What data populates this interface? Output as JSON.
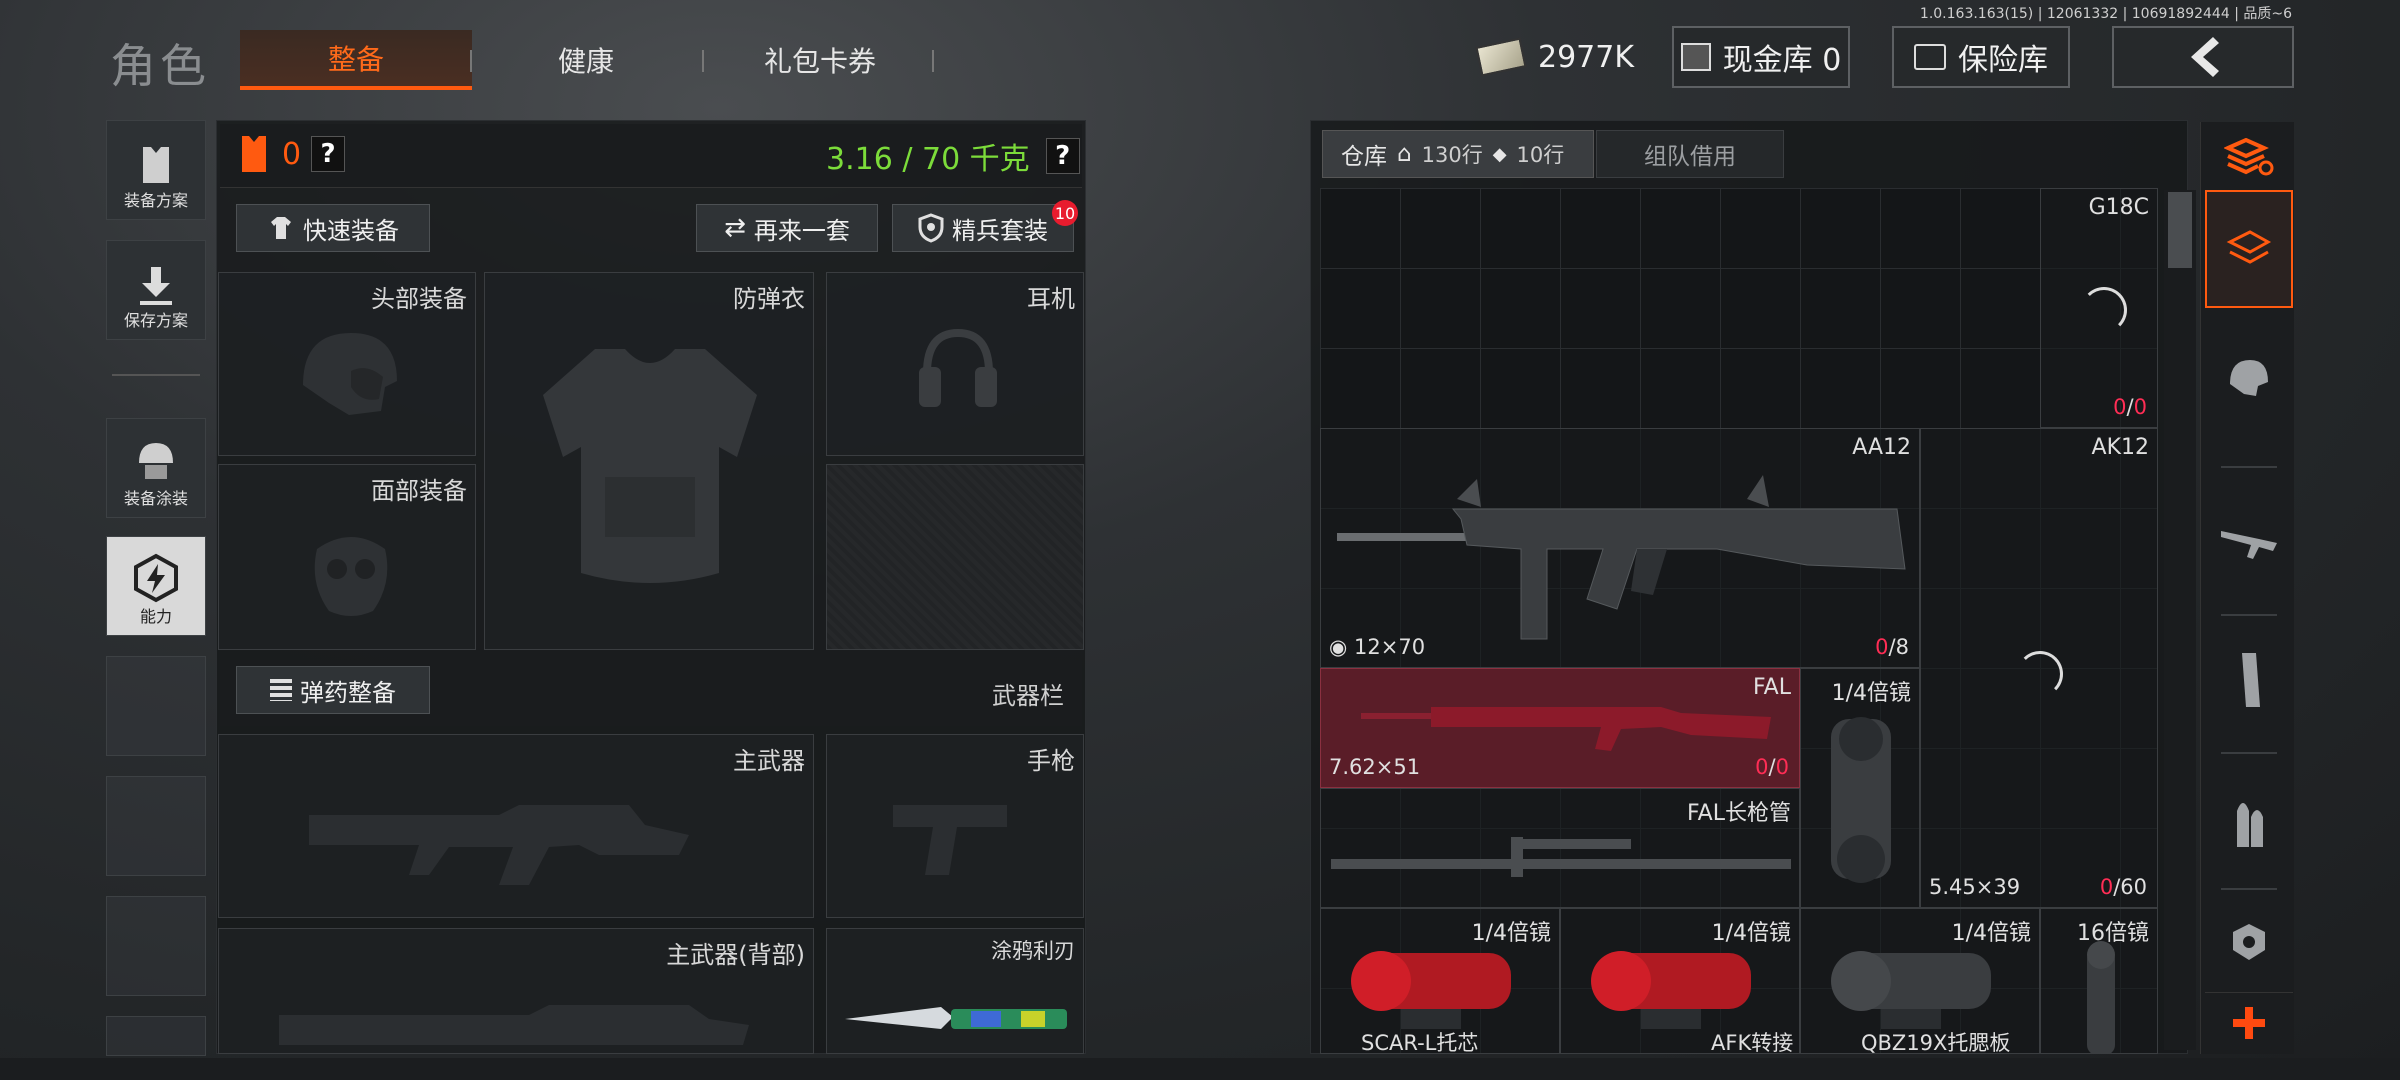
{
  "version": "1.0.163.163(15) | 12061332 | 10691892444 | 品质~6",
  "header": {
    "title": "角色",
    "tabs": [
      "整备",
      "健康",
      "礼包卡券"
    ],
    "active_tab": "整备",
    "money": "2977K",
    "cash_vault": "现金库 0",
    "safe_vault": "保险库"
  },
  "sidebar": {
    "items": [
      "装备方案",
      "保存方案",
      "装备涂装",
      "能力"
    ]
  },
  "loadout": {
    "armor_count": "0",
    "weight": "3.16 / 70 千克",
    "quick_equip": "快速装备",
    "again": "再来一套",
    "elite_set": "精兵套装",
    "elite_badge": "10",
    "slots": {
      "head": "头部装备",
      "vest": "防弹衣",
      "headset": "耳机",
      "face": "面部装备"
    },
    "ammo_equip": "弹药整备",
    "weapon_bar": "武器栏",
    "weapons": {
      "primary": "主武器",
      "pistol": "手枪",
      "primary_back": "主武器(背部)",
      "knife": "涂鸦利刃"
    }
  },
  "storage": {
    "tab_warehouse": "仓库",
    "rows_home": "130行",
    "rows_other": "10行",
    "tab_team": "组队借用",
    "items": {
      "g18c": {
        "name": "G18C",
        "cur": "0",
        "max": "0"
      },
      "aa12": {
        "name": "AA12",
        "caliber": "12×70",
        "cur": "0",
        "max": "8"
      },
      "ak12": {
        "name": "AK12",
        "caliber": "5.45×39",
        "cur": "0",
        "max": "60"
      },
      "fal": {
        "name": "FAL",
        "caliber": "7.62×51",
        "cur": "0",
        "max": "0"
      },
      "scope_tall": {
        "name": "1/4倍镜"
      },
      "fal_barrel": {
        "name": "FAL长枪管"
      },
      "scope_red1": {
        "name": "1/4倍镜",
        "sub": "SCAR-L托芯"
      },
      "scope_red2": {
        "name": "1/4倍镜",
        "sub": "AFK转接"
      },
      "scope_black": {
        "name": "1/4倍镜",
        "sub": "QBZ19X托腮板"
      },
      "scope_16": {
        "name": "16倍镜"
      }
    }
  },
  "colors": {
    "accent": "#ff5a10",
    "weight_green": "#7cdc3a",
    "count_red": "#ff2d55",
    "fal_highlight": "#5a1d28"
  }
}
